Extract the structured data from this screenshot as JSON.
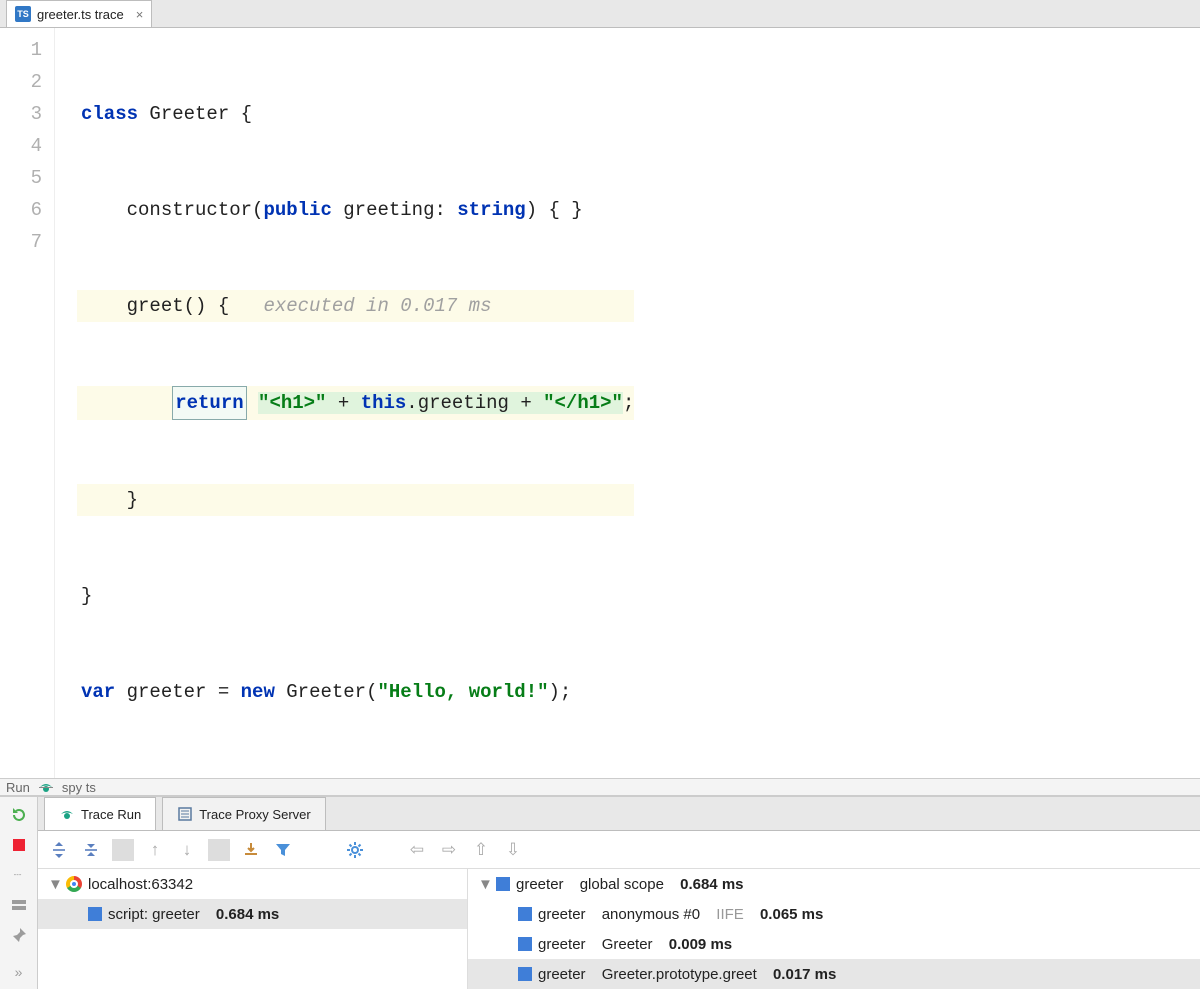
{
  "editor_tab": {
    "icon_text": "TS",
    "label": "greeter.ts trace"
  },
  "gutter": [
    "1",
    "2",
    "3",
    "4",
    "5",
    "6",
    "7"
  ],
  "code": {
    "l1_kw": "class",
    "l1_name": " Greeter {",
    "l2_pre": "    constructor(",
    "l2_kw": "public",
    "l2_mid": " greeting: ",
    "l2_kw2": "string",
    "l2_post": ") { }",
    "l3_pre": "    greet() {   ",
    "l3_lint": "executed in 0.017 ms",
    "l4_pre": "        ",
    "l4_ret": "return",
    "l4_sp": " ",
    "l4_s1": "\"<h1>\"",
    "l4_mid": " + ",
    "l4_kw": "this",
    "l4_mid2": ".greeting + ",
    "l4_s2": "\"</h1>\"",
    "l4_end": ";",
    "l5": "    }",
    "l6": "}",
    "l7_kw": "var",
    "l7_a": " greeter = ",
    "l7_kw2": "new",
    "l7_b": " Greeter(",
    "l7_s": "\"Hello, world!\"",
    "l7_c": ");"
  },
  "runbar": {
    "label": "Run",
    "config": "spy ts"
  },
  "ptabs": {
    "active": "Trace Run",
    "other": "Trace Proxy Server"
  },
  "tree_left": {
    "root": "localhost:63342",
    "child_label": "script: greeter",
    "child_time": "0.684 ms"
  },
  "tree_right": {
    "r0_a": "greeter",
    "r0_b": "global scope",
    "r0_t": "0.684 ms",
    "r1_a": "greeter",
    "r1_b": "anonymous #0",
    "r1_c": "IIFE",
    "r1_t": "0.065 ms",
    "r2_a": "greeter",
    "r2_b": "Greeter",
    "r2_t": "0.009 ms",
    "r3_a": "greeter",
    "r3_b": "Greeter.prototype.greet",
    "r3_t": "0.017 ms"
  }
}
